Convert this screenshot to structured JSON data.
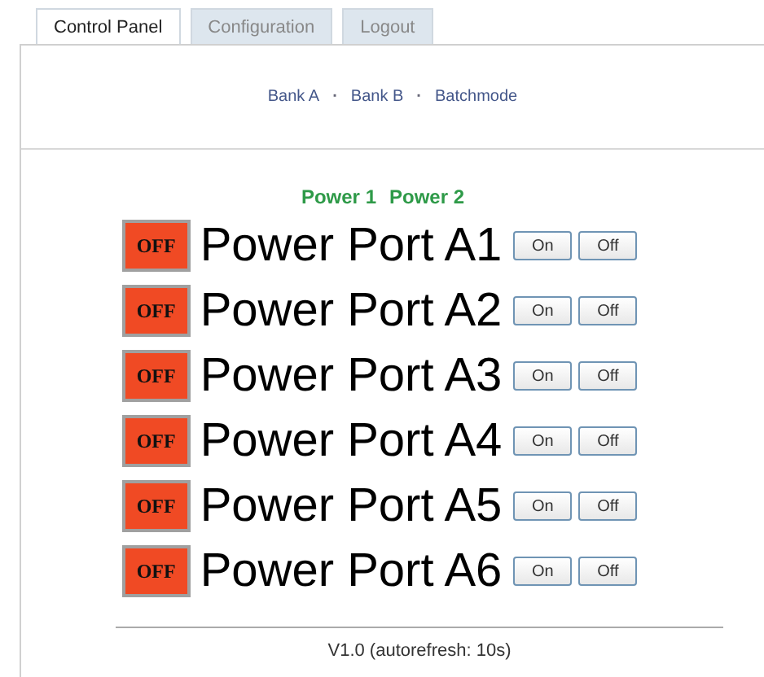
{
  "tabs": [
    {
      "label": "Control Panel",
      "selected": true
    },
    {
      "label": "Configuration",
      "selected": false
    },
    {
      "label": "Logout",
      "selected": false
    }
  ],
  "nav": [
    {
      "kind": "link",
      "text": "Bank A"
    },
    {
      "kind": "separator",
      "text": "·"
    },
    {
      "kind": "link",
      "text": "Bank B"
    },
    {
      "kind": "separator",
      "text": "·"
    },
    {
      "kind": "link",
      "text": "Batchmode"
    }
  ],
  "power_headers": [
    "Power 1",
    "Power 2"
  ],
  "ports": [
    {
      "status": "OFF",
      "on": false,
      "name": "Power Port A1",
      "on_button": "On",
      "off_button": "Off"
    },
    {
      "status": "OFF",
      "on": false,
      "name": "Power Port A2",
      "on_button": "On",
      "off_button": "Off"
    },
    {
      "status": "OFF",
      "on": false,
      "name": "Power Port A3",
      "on_button": "On",
      "off_button": "Off"
    },
    {
      "status": "OFF",
      "on": false,
      "name": "Power Port A4",
      "on_button": "On",
      "off_button": "Off"
    },
    {
      "status": "OFF",
      "on": false,
      "name": "Power Port A5",
      "on_button": "On",
      "off_button": "Off"
    },
    {
      "status": "OFF",
      "on": false,
      "name": "Power Port A6",
      "on_button": "On",
      "off_button": "Off"
    }
  ],
  "footer": "V1.0 (autorefresh: 10s)"
}
